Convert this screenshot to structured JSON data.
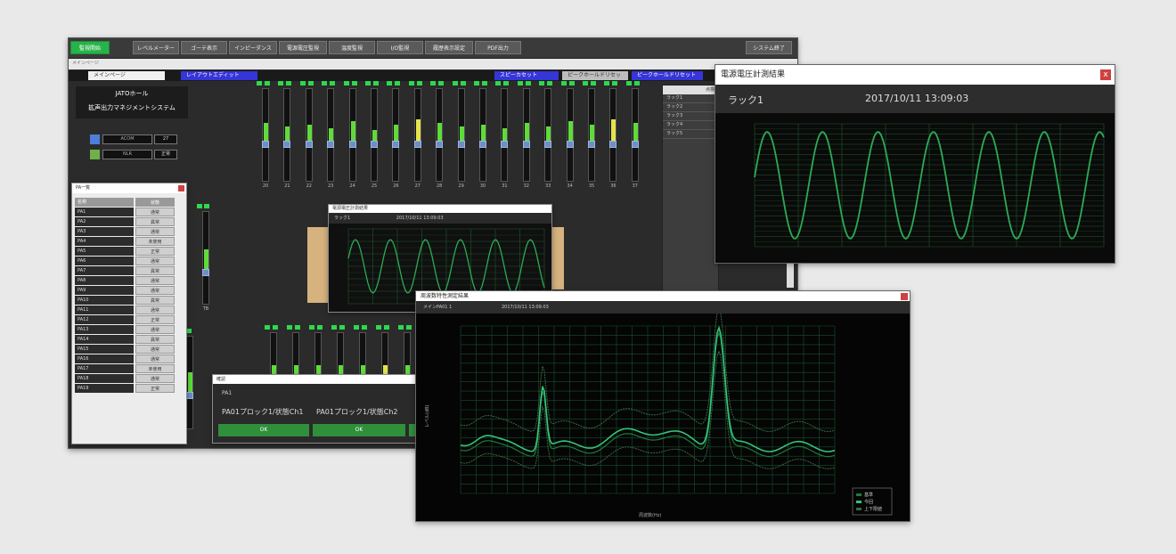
{
  "colors": {
    "accent_green": "#2fd84d",
    "tab_blue": "#3535d8",
    "close_red": "#d04040",
    "trace_green": "#2eaa55"
  },
  "main": {
    "toolbar": {
      "start_label": "監視開始",
      "buttons": [
        "レベルメーター",
        "ゴーテ表示",
        "インピーダンス",
        "電源電圧監視",
        "温度監視",
        "I/O監視",
        "履歴表示設定",
        "PDF出力"
      ],
      "exit_label": "システム終了"
    },
    "subbar": "メインページ",
    "tabs": {
      "main": "メインページ",
      "layout": "レイアウトエディット",
      "speaker": "スピーカセット",
      "peak_a": "ピークホールドリセット",
      "peak_b": "ピークホールドリセット"
    },
    "hall": {
      "name": "JATOホール",
      "system": "拡声出力マネジメントシステム"
    },
    "status": [
      {
        "label": "ACOM",
        "value": "27"
      },
      {
        "label": "NLR",
        "value": "正常"
      }
    ],
    "channel_numbers": [
      "20",
      "21",
      "22",
      "23",
      "24",
      "25",
      "26",
      "27",
      "28",
      "29",
      "30",
      "31",
      "32",
      "33",
      "34",
      "35",
      "36",
      "37"
    ],
    "bottom_label": "TB",
    "rack_list": {
      "header": "点検",
      "items": [
        "ラック1",
        "ラック2",
        "ラック3",
        "ラック4",
        "ラック5"
      ]
    }
  },
  "pa_panel": {
    "title": "PA一覧",
    "head": {
      "name": "名称",
      "status": "状態"
    },
    "rows": [
      {
        "name": "PA1",
        "status": "通常"
      },
      {
        "name": "PA2",
        "status": "異常"
      },
      {
        "name": "PA3",
        "status": "通常"
      },
      {
        "name": "PA4",
        "status": "未使用"
      },
      {
        "name": "PA5",
        "status": "正常"
      },
      {
        "name": "PA6",
        "status": "通常"
      },
      {
        "name": "PA7",
        "status": "異常"
      },
      {
        "name": "PA8",
        "status": "通常"
      },
      {
        "name": "PA9",
        "status": "通常"
      },
      {
        "name": "PA10",
        "status": "異常"
      },
      {
        "name": "PA11",
        "status": "通常"
      },
      {
        "name": "PA12",
        "status": "正常"
      },
      {
        "name": "PA13",
        "status": "通常"
      },
      {
        "name": "PA14",
        "status": "異常"
      },
      {
        "name": "PA15",
        "status": "通常"
      },
      {
        "name": "PA16",
        "status": "通常"
      },
      {
        "name": "PA17",
        "status": "未使用"
      },
      {
        "name": "PA18",
        "status": "通常"
      },
      {
        "name": "PA19",
        "status": "正常"
      }
    ]
  },
  "mini_window": {
    "title": "電源電圧計測結果",
    "rack": "ラック1",
    "datetime": "2017/10/11 13:09:03"
  },
  "ok_dialog": {
    "title": "確認",
    "id": "PA1",
    "line_a": "PA01プロック1/状態Ch1",
    "line_b": "PA01プロック1/状態Ch2",
    "buttons": [
      "OK",
      "OK"
    ]
  },
  "result_window": {
    "title": "電源電圧計測結果",
    "close_label": "x",
    "rack": "ラック1",
    "datetime": "2017/10/11 13:09:03"
  },
  "freq_window": {
    "title": "周波数特性測定結果",
    "channel": "メインPA01 1",
    "datetime": "2017/10/11 13:09:03",
    "ylabel": "レベル(dB)",
    "xlabel": "周波数(Hz)",
    "legend": [
      "基準",
      "今回",
      "上下限値"
    ]
  }
}
